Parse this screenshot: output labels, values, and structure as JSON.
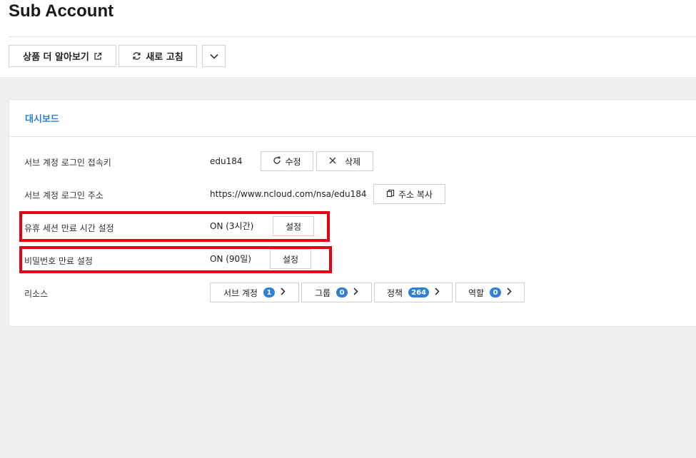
{
  "page": {
    "title": "Sub Account"
  },
  "toolbar": {
    "learn_more_label": "상품 더 알아보기",
    "refresh_label": "새로 고침"
  },
  "dashboard": {
    "title": "대시보드",
    "rows": {
      "login_key": {
        "label": "서브 계정 로그인 접속키",
        "value": "edu184",
        "edit_label": "수정",
        "delete_label": "삭제"
      },
      "login_address": {
        "label": "서브 계정 로그인 주소",
        "value": "https://www.ncloud.com/nsa/edu184",
        "copy_label": "주소 복사"
      },
      "session_expiry": {
        "label": "유휴 세션 만료 시간 설정",
        "value": "ON (3시간)",
        "setting_label": "설정"
      },
      "password_expiry": {
        "label": "비밀번호 만료 설정",
        "value": "ON (90일)",
        "setting_label": "설정"
      },
      "resources": {
        "label": "리소스",
        "items": [
          {
            "label": "서브 계정",
            "count": "1"
          },
          {
            "label": "그룹",
            "count": "0"
          },
          {
            "label": "정책",
            "count": "264"
          },
          {
            "label": "역할",
            "count": "0"
          }
        ]
      }
    }
  },
  "colors": {
    "accent": "#2c7fd3",
    "badge": "#2f7fd6",
    "highlight": "#e60012",
    "background": "#efefef"
  },
  "icons": [
    "external-link-icon",
    "refresh-icon",
    "chevron-down-icon",
    "rotate-icon",
    "close-icon",
    "copy-icon",
    "chevron-right-icon"
  ]
}
